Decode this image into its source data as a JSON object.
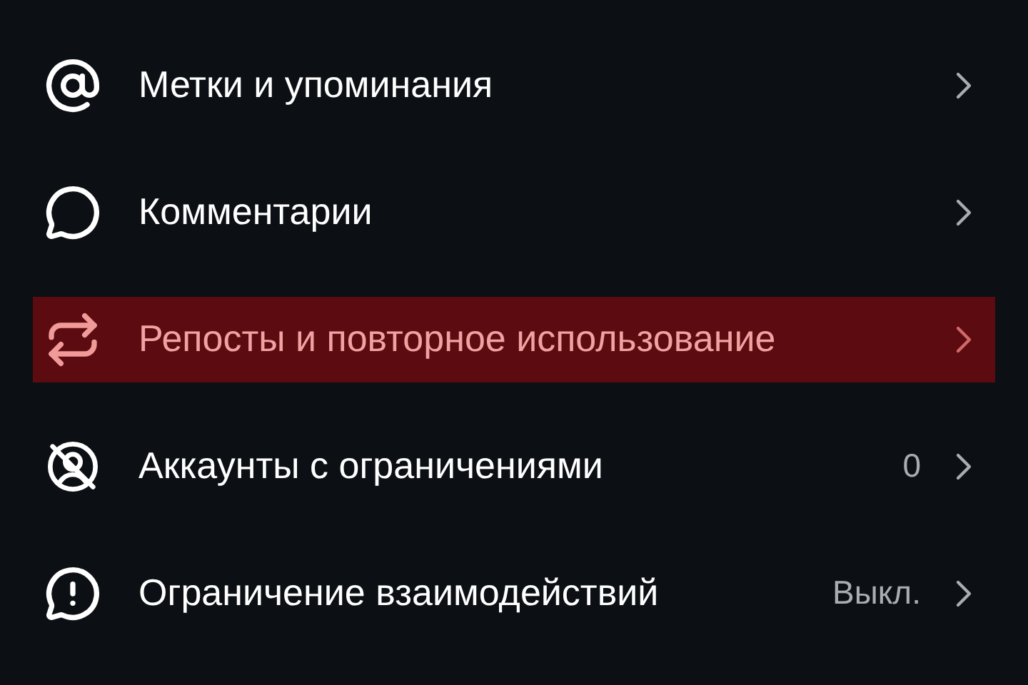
{
  "items": [
    {
      "kind": "at",
      "label": "Метки и упоминания",
      "selected": false
    },
    {
      "kind": "comment",
      "label": "Комментарии",
      "selected": false
    },
    {
      "kind": "repost",
      "label": "Репосты и повторное использование",
      "selected": true
    },
    {
      "kind": "restricted",
      "label": "Аккаунты с ограничениями",
      "value": "0",
      "selected": false
    },
    {
      "kind": "alert",
      "label": "Ограничение взаимодействий",
      "value": "Выкл.",
      "selected": false
    }
  ]
}
